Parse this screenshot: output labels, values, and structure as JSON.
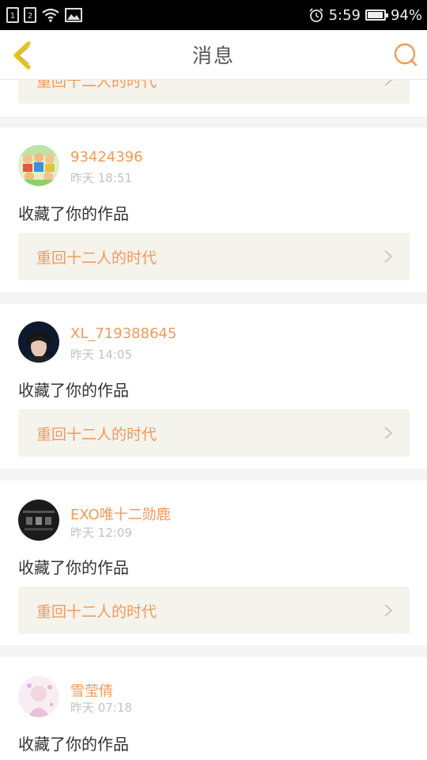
{
  "status_bar": {
    "sim1": "1",
    "sim2": "2",
    "time": "5:59",
    "battery": "94%",
    "battery_level": 0.94,
    "icons": [
      "sim-card-icon",
      "wifi-icon",
      "image-notification-icon",
      "alarm-icon",
      "battery-icon"
    ]
  },
  "header": {
    "title": "消息",
    "back_icon": "chevron-left-icon",
    "search_icon": "search-icon",
    "accent_color": "#f29a5a",
    "back_color": "#e8c20c"
  },
  "partial_item": {
    "work_title": "重回十二人的时代"
  },
  "messages": [
    {
      "username": "93424396",
      "time": "昨天 18:51",
      "action": "收藏了你的作品",
      "work_title": "重回十二人的时代"
    },
    {
      "username": "XL_719388645",
      "time": "昨天 14:05",
      "action": "收藏了你的作品",
      "work_title": "重回十二人的时代"
    },
    {
      "username": "EXO唯十二勋鹿",
      "time": "昨天 12:09",
      "action": "收藏了你的作品",
      "work_title": "重回十二人的时代"
    },
    {
      "username": "雪莹倩",
      "time": "昨天 07:18",
      "action": "收藏了你的作品"
    }
  ]
}
